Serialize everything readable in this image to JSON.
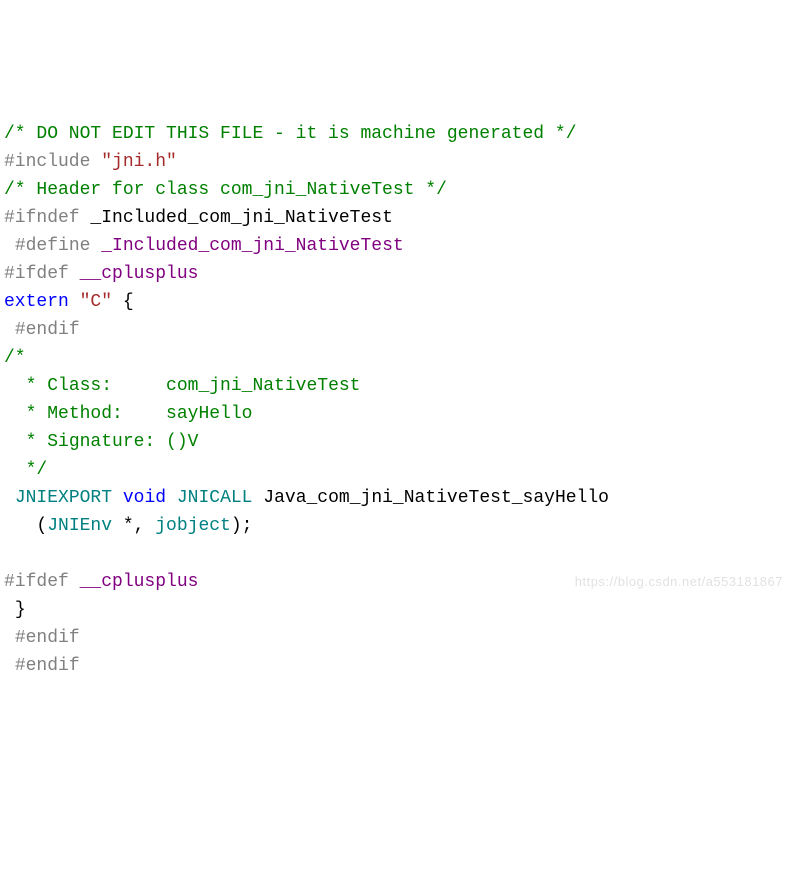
{
  "code": {
    "lines": [
      {
        "segments": [
          {
            "cls": "comment",
            "text": "/* DO NOT EDIT THIS FILE - it is machine generated */"
          }
        ]
      },
      {
        "segments": [
          {
            "cls": "preproc",
            "text": "#include "
          },
          {
            "cls": "string",
            "text": "\"jni.h\""
          }
        ]
      },
      {
        "segments": [
          {
            "cls": "comment",
            "text": "/* Header for class com_jni_NativeTest */"
          }
        ]
      },
      {
        "segments": [
          {
            "cls": "",
            "text": ""
          }
        ]
      },
      {
        "prefix": "gutter",
        "segments": [
          {
            "cls": "preproc",
            "text": "#ifndef "
          },
          {
            "cls": "",
            "text": "_Included_com_jni_NativeTest"
          }
        ]
      },
      {
        "indent": 1,
        "segments": [
          {
            "cls": "preproc",
            "text": "#define "
          },
          {
            "cls": "macro-name",
            "text": "_Included_com_jni_NativeTest"
          }
        ]
      },
      {
        "prefix": "gutter",
        "segments": [
          {
            "cls": "preproc",
            "text": "#ifdef "
          },
          {
            "cls": "macro-name",
            "text": "__cplusplus"
          }
        ]
      },
      {
        "prefix": "gutter",
        "segments": [
          {
            "cls": "keyword",
            "text": "extern"
          },
          {
            "cls": "",
            "text": " "
          },
          {
            "cls": "string",
            "text": "\"C\""
          },
          {
            "cls": "",
            "text": " {"
          }
        ]
      },
      {
        "indent": 1,
        "segments": [
          {
            "cls": "preproc",
            "text": "#endif"
          }
        ]
      },
      {
        "prefix": "gutter",
        "segments": [
          {
            "cls": "comment",
            "text": "/*"
          }
        ]
      },
      {
        "indent": 1,
        "segments": [
          {
            "cls": "comment",
            "text": " * Class:     com_jni_NativeTest"
          }
        ]
      },
      {
        "indent": 1,
        "segments": [
          {
            "cls": "comment",
            "text": " * Method:    sayHello"
          }
        ]
      },
      {
        "indent": 1,
        "segments": [
          {
            "cls": "comment",
            "text": " * Signature: ()V"
          }
        ]
      },
      {
        "indent": 1,
        "segments": [
          {
            "cls": "comment",
            "text": " */"
          }
        ]
      },
      {
        "indent": 1,
        "segments": [
          {
            "cls": "type",
            "text": "JNIEXPORT"
          },
          {
            "cls": "",
            "text": " "
          },
          {
            "cls": "void",
            "text": "void"
          },
          {
            "cls": "",
            "text": " "
          },
          {
            "cls": "type",
            "text": "JNICALL"
          },
          {
            "cls": "",
            "text": " Java_com_jni_NativeTest_sayHello"
          }
        ]
      },
      {
        "indent": 1,
        "segments": [
          {
            "cls": "",
            "text": "  ("
          },
          {
            "cls": "type",
            "text": "JNIEnv"
          },
          {
            "cls": "",
            "text": " *, "
          },
          {
            "cls": "type",
            "text": "jobject"
          },
          {
            "cls": "",
            "text": ");"
          }
        ]
      },
      {
        "indent": 1,
        "segments": [
          {
            "cls": "",
            "text": ""
          }
        ]
      },
      {
        "prefix": "gutter",
        "segments": [
          {
            "cls": "preproc",
            "text": "#ifdef "
          },
          {
            "cls": "macro-name",
            "text": "__cplusplus"
          }
        ]
      },
      {
        "indent": 1,
        "segments": [
          {
            "cls": "",
            "text": "}"
          }
        ]
      },
      {
        "indent": 1,
        "segments": [
          {
            "cls": "preproc",
            "text": "#endif"
          }
        ]
      },
      {
        "indent": 1,
        "segments": [
          {
            "cls": "preproc",
            "text": "#endif"
          }
        ]
      }
    ]
  },
  "watermark": "https://blog.csdn.net/a553181867"
}
